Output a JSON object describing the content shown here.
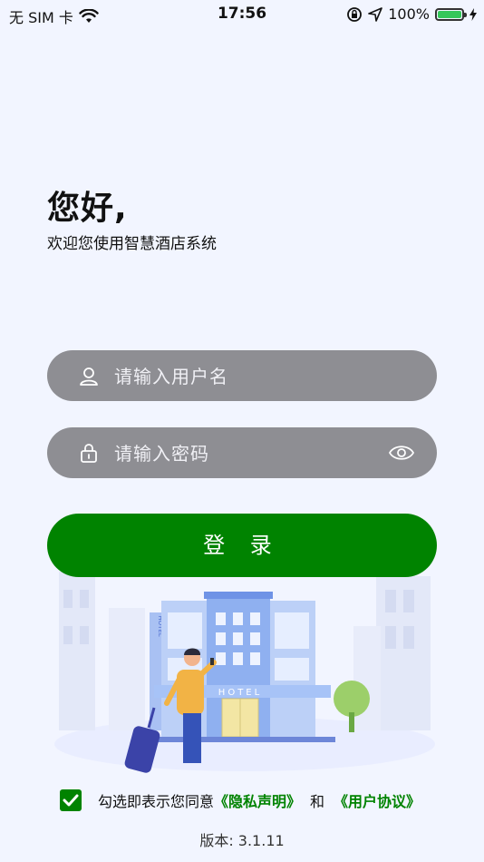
{
  "status_bar": {
    "carrier": "无 SIM 卡",
    "time": "17:56",
    "battery_text": "100%",
    "battery_level": 1.0
  },
  "greeting": {
    "title": "您好,",
    "subtitle": "欢迎您使用智慧酒店系统"
  },
  "form": {
    "username_placeholder": "请输入用户名",
    "password_placeholder": "请输入密码",
    "login_label": "登 录"
  },
  "illustration": {
    "sign": "HOTEL",
    "side_sign": "HOTEL"
  },
  "agreement": {
    "checked": true,
    "prefix": "勾选即表示您同意",
    "privacy_link": "《隐私声明》",
    "and": "和",
    "user_link": "《用户协议》"
  },
  "version": "版本: 3.1.11",
  "colors": {
    "brand_green": "#008300",
    "field_gray": "#8e8e93",
    "background": "#f2f5ff"
  }
}
